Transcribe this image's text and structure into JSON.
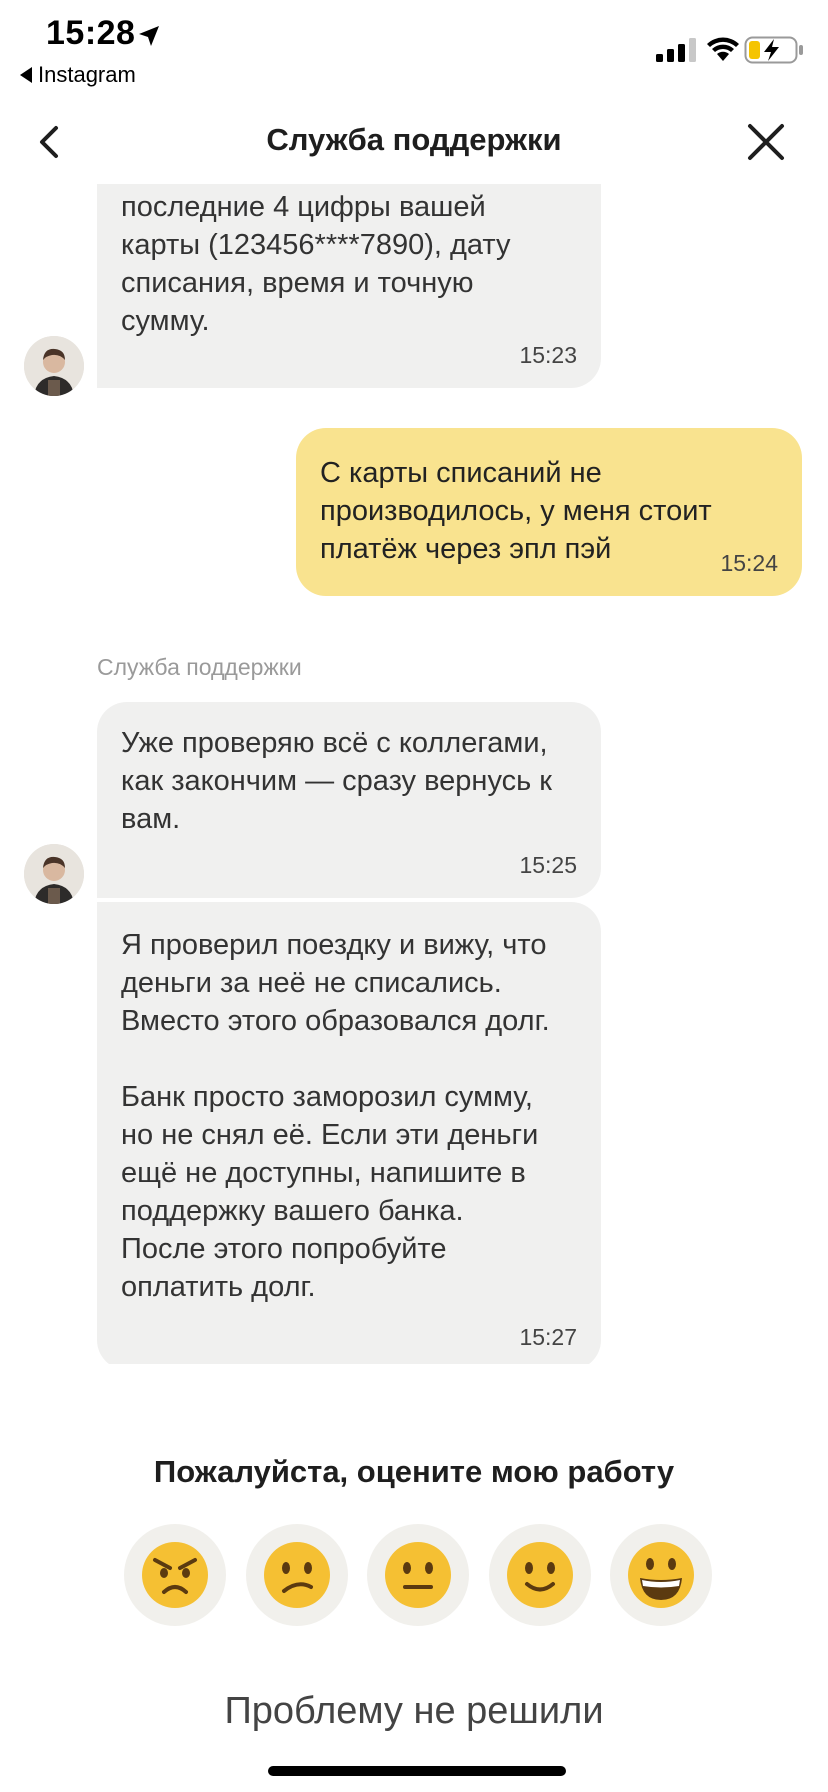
{
  "status_bar": {
    "time": "15:28",
    "back_app": "Instagram",
    "icons": [
      "location-arrow-icon",
      "cellular-signal-icon",
      "wifi-icon",
      "battery-charging-icon"
    ]
  },
  "header": {
    "title": "Служба поддержки",
    "back_icon": "chevron-left-icon",
    "close_icon": "close-icon"
  },
  "messages": [
    {
      "author": "support",
      "text": "последние 4 цифры вашей\nкарты (123456****7890), дату\nсписания, время и точную\nсумму.",
      "time": "15:23"
    },
    {
      "author": "user",
      "text": "С карты списаний не\nпроизводилось, у меня стоит\nплатёж через эпл пэй",
      "time": "15:24"
    },
    {
      "author": "support",
      "sender_label": "Служба поддержки",
      "text": "Уже проверяю всё с коллегами,\nкак закончим — сразу вернусь к\nвам.",
      "time": "15:25"
    },
    {
      "author": "support",
      "text": "Я проверил поездку и вижу, что\nденьги за неё не списались.\nВместо этого образовался долг.\n\nБанк просто заморозил сумму,\nно не снял её. Если эти деньги\nещё не доступны, напишите в\nподдержку вашего банка.\nПосле этого попробуйте\nоплатить долг.",
      "time": "15:27"
    }
  ],
  "rating": {
    "title": "Пожалуйста, оцените мою работу",
    "faces": [
      "angry-face-icon",
      "confused-face-icon",
      "neutral-face-icon",
      "slightly-smiling-face-icon",
      "grinning-face-icon"
    ]
  },
  "unsolved_label": "Проблему не решили",
  "colors": {
    "incoming_bubble": "#f0f0ef",
    "outgoing_bubble": "#f9e38f",
    "face_bg": "#f1f0ec",
    "emoji_yellow": "#f5c033"
  }
}
